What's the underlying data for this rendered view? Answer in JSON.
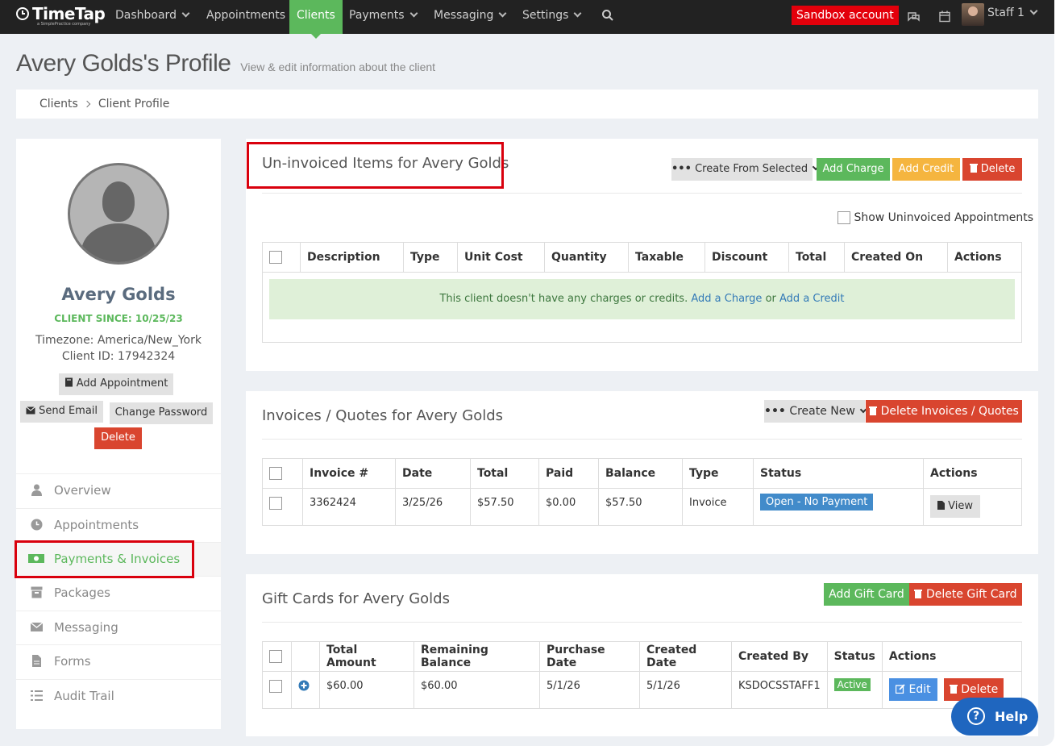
{
  "nav": {
    "logo": "TimeTap",
    "logo_sub": "a SimplePractice company",
    "items": [
      {
        "label": "Dashboard",
        "caret": true
      },
      {
        "label": "Appointments",
        "caret": false
      },
      {
        "label": "Clients",
        "caret": false,
        "active": true
      },
      {
        "label": "Payments",
        "caret": true
      },
      {
        "label": "Messaging",
        "caret": true
      },
      {
        "label": "Settings",
        "caret": true
      }
    ],
    "sandbox": "Sandbox account",
    "staff": "Staff 1"
  },
  "header": {
    "title": "Avery Golds's Profile",
    "subtitle": "View & edit information about the client"
  },
  "breadcrumb": [
    "Clients",
    "Client Profile"
  ],
  "sidebar": {
    "name": "Avery Golds",
    "client_since": "CLIENT SINCE: 10/25/23",
    "timezone": "Timezone: America/New_York",
    "client_id": "Client ID: 17942324",
    "add_appointment": "Add Appointment",
    "send_email": "Send Email",
    "change_password": "Change Password",
    "delete": "Delete",
    "menu": [
      {
        "label": "Overview",
        "icon": "user-icon"
      },
      {
        "label": "Appointments",
        "icon": "clock-icon"
      },
      {
        "label": "Payments & Invoices",
        "icon": "money-icon",
        "active": true
      },
      {
        "label": "Packages",
        "icon": "archive-icon"
      },
      {
        "label": "Messaging",
        "icon": "envelope-icon"
      },
      {
        "label": "Forms",
        "icon": "file-icon"
      },
      {
        "label": "Audit Trail",
        "icon": "list-icon"
      }
    ]
  },
  "uninvoiced": {
    "title": "Un-invoiced Items for Avery Golds",
    "create_from_selected": "Create From Selected",
    "add_charge": "Add Charge",
    "add_credit": "Add Credit",
    "delete": "Delete",
    "show_label": "Show Uninvoiced Appointments",
    "columns": [
      "Description",
      "Type",
      "Unit Cost",
      "Quantity",
      "Taxable",
      "Discount",
      "Total",
      "Created On",
      "Actions"
    ],
    "empty_text": "This client doesn't have any charges or credits.",
    "empty_link1": "Add a Charge",
    "empty_or": "or",
    "empty_link2": "Add a Credit"
  },
  "invoices": {
    "title": "Invoices / Quotes for Avery Golds",
    "create_new": "Create New",
    "delete_btn": "Delete Invoices / Quotes",
    "columns": [
      "Invoice #",
      "Date",
      "Total",
      "Paid",
      "Balance",
      "Type",
      "Status",
      "Actions"
    ],
    "rows": [
      {
        "invoice": "3362424",
        "date": "3/25/26",
        "total": "$57.50",
        "paid": "$0.00",
        "balance": "$57.50",
        "type": "Invoice",
        "status": "Open - No Payment",
        "action": "View"
      }
    ]
  },
  "giftcards": {
    "title": "Gift Cards for Avery Golds",
    "add_btn": "Add Gift Card",
    "delete_btn": "Delete Gift Card",
    "columns": [
      "Total Amount",
      "Remaining Balance",
      "Purchase Date",
      "Created Date",
      "Created By",
      "Status",
      "Actions"
    ],
    "rows": [
      {
        "total": "$60.00",
        "remaining": "$60.00",
        "purchase": "5/1/26",
        "created": "5/1/26",
        "by": "KSDOCSSTAFF1",
        "status": "Active",
        "edit": "Edit",
        "delete": "Delete"
      }
    ]
  },
  "help": "Help",
  "colors": {
    "nav_bg": "#222222",
    "accent_green": "#5cb85c",
    "danger_red": "#d9452f",
    "sandbox_red": "#e3000b",
    "highlight_box": "#d9000d"
  }
}
